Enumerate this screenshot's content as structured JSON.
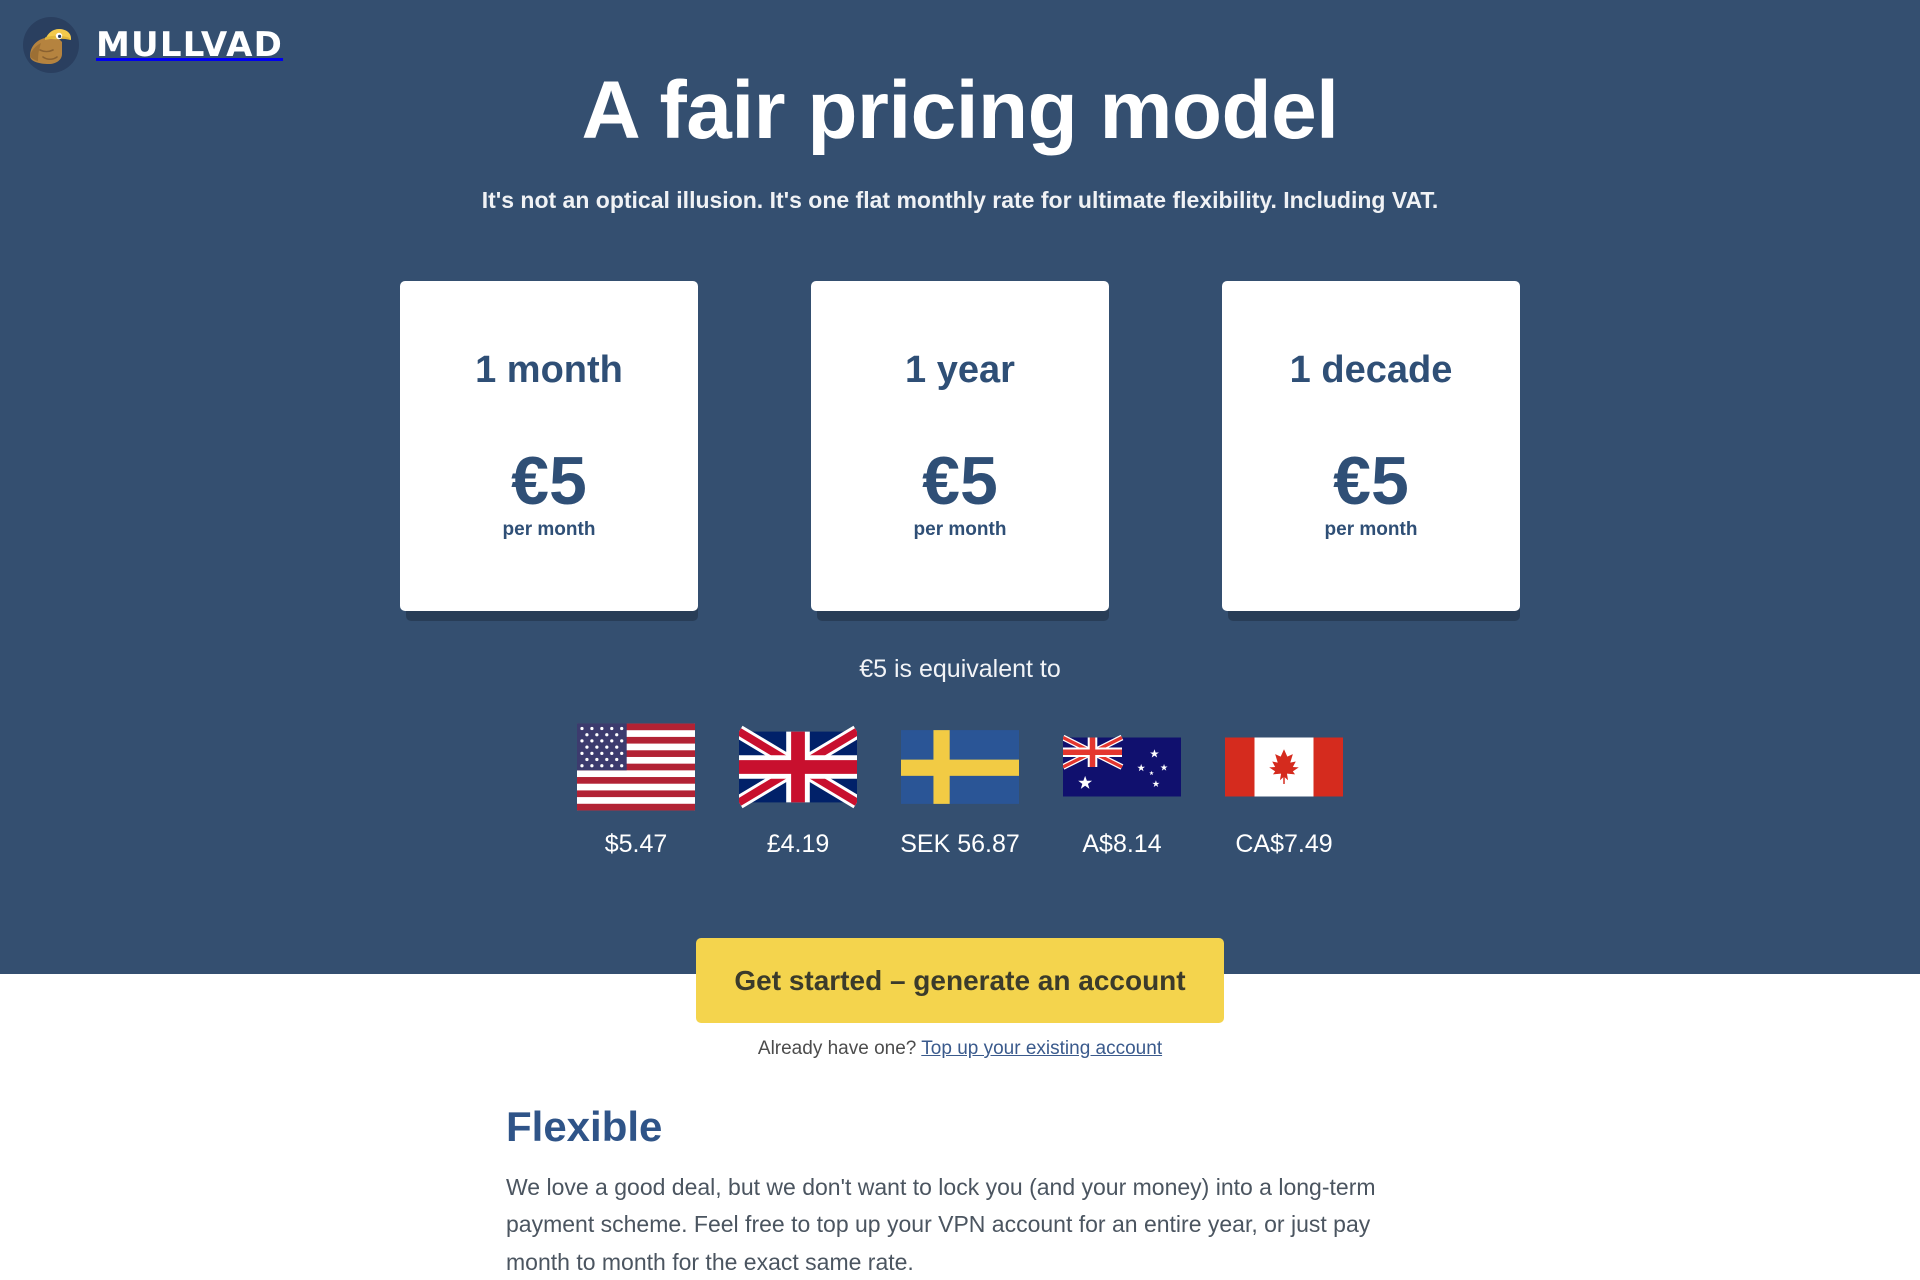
{
  "brand": {
    "name": "MULLVAD",
    "logo_icon": "mullvad-mole-icon",
    "logo_circle_color": "#2a3f5f",
    "logo_hat_color": "#f2c94c",
    "logo_mole_color": "#b5833f"
  },
  "hero": {
    "title": "A fair pricing model",
    "subtitle": "It's not an optical illusion. It's one flat monthly rate for ultimate flexibility. Including VAT.",
    "background_color": "#344f70"
  },
  "plans": [
    {
      "term": "1 month",
      "price": "€5",
      "period": "per month"
    },
    {
      "term": "1 year",
      "price": "€5",
      "period": "per month"
    },
    {
      "term": "1 decade",
      "price": "€5",
      "period": "per month"
    }
  ],
  "equivalents": {
    "label": "€5 is equivalent to",
    "items": [
      {
        "flag_icon": "flag-united-states-icon",
        "country": "United States",
        "amount": "$5.47"
      },
      {
        "flag_icon": "flag-united-kingdom-icon",
        "country": "United Kingdom",
        "amount": "£4.19"
      },
      {
        "flag_icon": "flag-sweden-icon",
        "country": "Sweden",
        "amount": "SEK 56.87"
      },
      {
        "flag_icon": "flag-australia-icon",
        "country": "Australia",
        "amount": "A$8.14"
      },
      {
        "flag_icon": "flag-canada-icon",
        "country": "Canada",
        "amount": "CA$7.49"
      }
    ]
  },
  "cta": {
    "button_label": "Get started – generate an account",
    "button_color": "#f4d44d",
    "already_text": "Already have one?",
    "link_text": "Top up your existing account",
    "link_color": "#3a5a8c"
  },
  "flexible": {
    "heading": "Flexible",
    "heading_color": "#2f5488",
    "body": "We love a good deal, but we don't want to lock you (and your money) into a long-term payment scheme. Feel free to top up your VPN account for an entire year, or just pay month to month for the exact same rate."
  }
}
